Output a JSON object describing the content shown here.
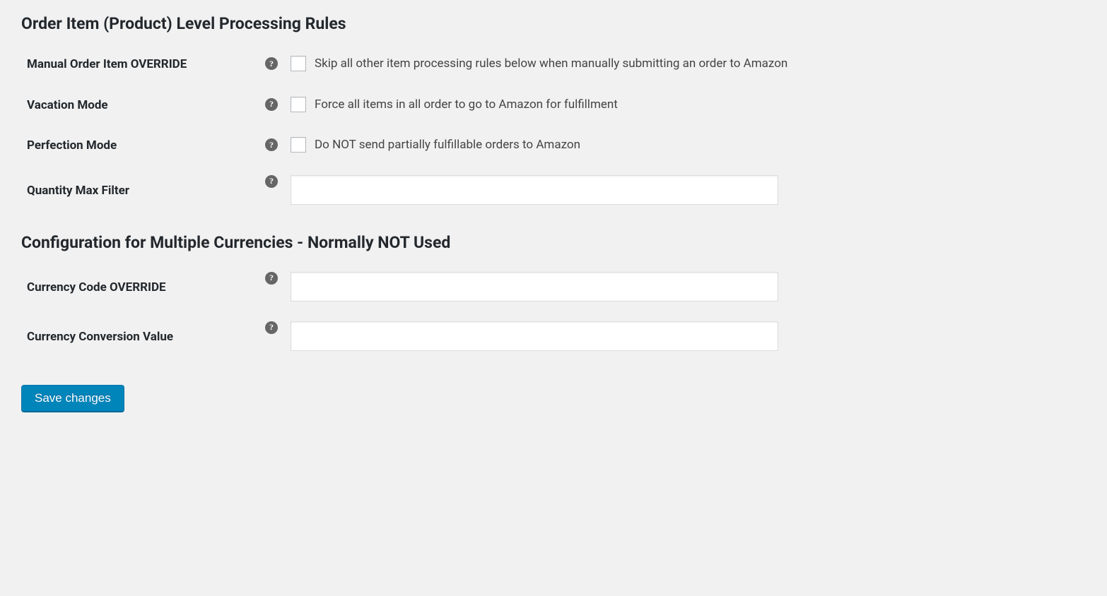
{
  "section1": {
    "heading": "Order Item (Product) Level Processing Rules",
    "rows": {
      "manual_override": {
        "label": "Manual Order Item OVERRIDE",
        "description": "Skip all other item processing rules below when manually submitting an order to Amazon"
      },
      "vacation_mode": {
        "label": "Vacation Mode",
        "description": "Force all items in all order to go to Amazon for fulfillment"
      },
      "perfection_mode": {
        "label": "Perfection Mode",
        "description": "Do NOT send partially fulfillable orders to Amazon"
      },
      "quantity_max": {
        "label": "Quantity Max Filter",
        "value": ""
      }
    }
  },
  "section2": {
    "heading": "Configuration for Multiple Currencies - Normally NOT Used",
    "rows": {
      "currency_code": {
        "label": "Currency Code OVERRIDE",
        "value": ""
      },
      "currency_conversion": {
        "label": "Currency Conversion Value",
        "value": ""
      }
    }
  },
  "buttons": {
    "save": "Save changes"
  }
}
